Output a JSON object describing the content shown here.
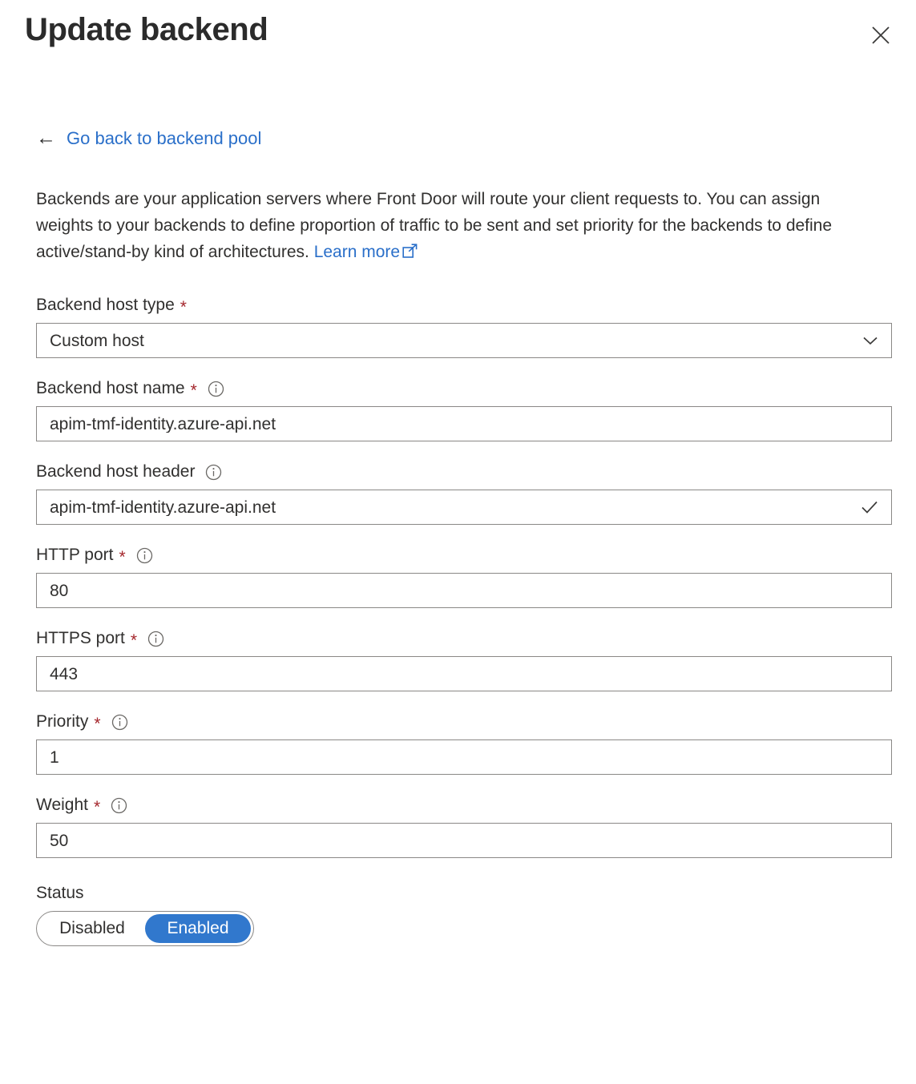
{
  "header": {
    "title": "Update backend",
    "close_icon": "close-icon"
  },
  "back_link": {
    "arrow": "←",
    "label": "Go back to backend pool"
  },
  "description": {
    "text": "Backends are your application servers where Front Door will route your client requests to. You can assign weights to your backends to define proportion of traffic to be sent and set priority for the backends to define active/stand-by kind of architectures.",
    "learn_more_label": "Learn more",
    "external_icon": "external-link-icon"
  },
  "colors": {
    "link_blue": "#2a6fc9",
    "toggle_blue": "#3178cd",
    "required_red": "#a4262c",
    "border_gray": "#8a8886",
    "text": "#31302f"
  },
  "fields": {
    "host_type": {
      "label": "Backend host type",
      "required": "*",
      "value": "Custom host",
      "affix_icon": "chevron-down-icon",
      "options": [
        "Custom host"
      ]
    },
    "host_name": {
      "label": "Backend host name",
      "required": "*",
      "info_icon": "info-icon",
      "value": "apim-tmf-identity.azure-api.net"
    },
    "host_header": {
      "label": "Backend host header",
      "info_icon": "info-icon",
      "value": "apim-tmf-identity.azure-api.net",
      "affix_icon": "checkmark-icon"
    },
    "http_port": {
      "label": "HTTP port",
      "required": "*",
      "info_icon": "info-icon",
      "value": "80"
    },
    "https_port": {
      "label": "HTTPS port",
      "required": "*",
      "info_icon": "info-icon",
      "value": "443"
    },
    "priority": {
      "label": "Priority",
      "required": "*",
      "info_icon": "info-icon",
      "value": "1"
    },
    "weight": {
      "label": "Weight",
      "required": "*",
      "info_icon": "info-icon",
      "value": "50"
    },
    "status": {
      "label": "Status",
      "options": [
        "Disabled",
        "Enabled"
      ],
      "selected": "Enabled"
    }
  }
}
